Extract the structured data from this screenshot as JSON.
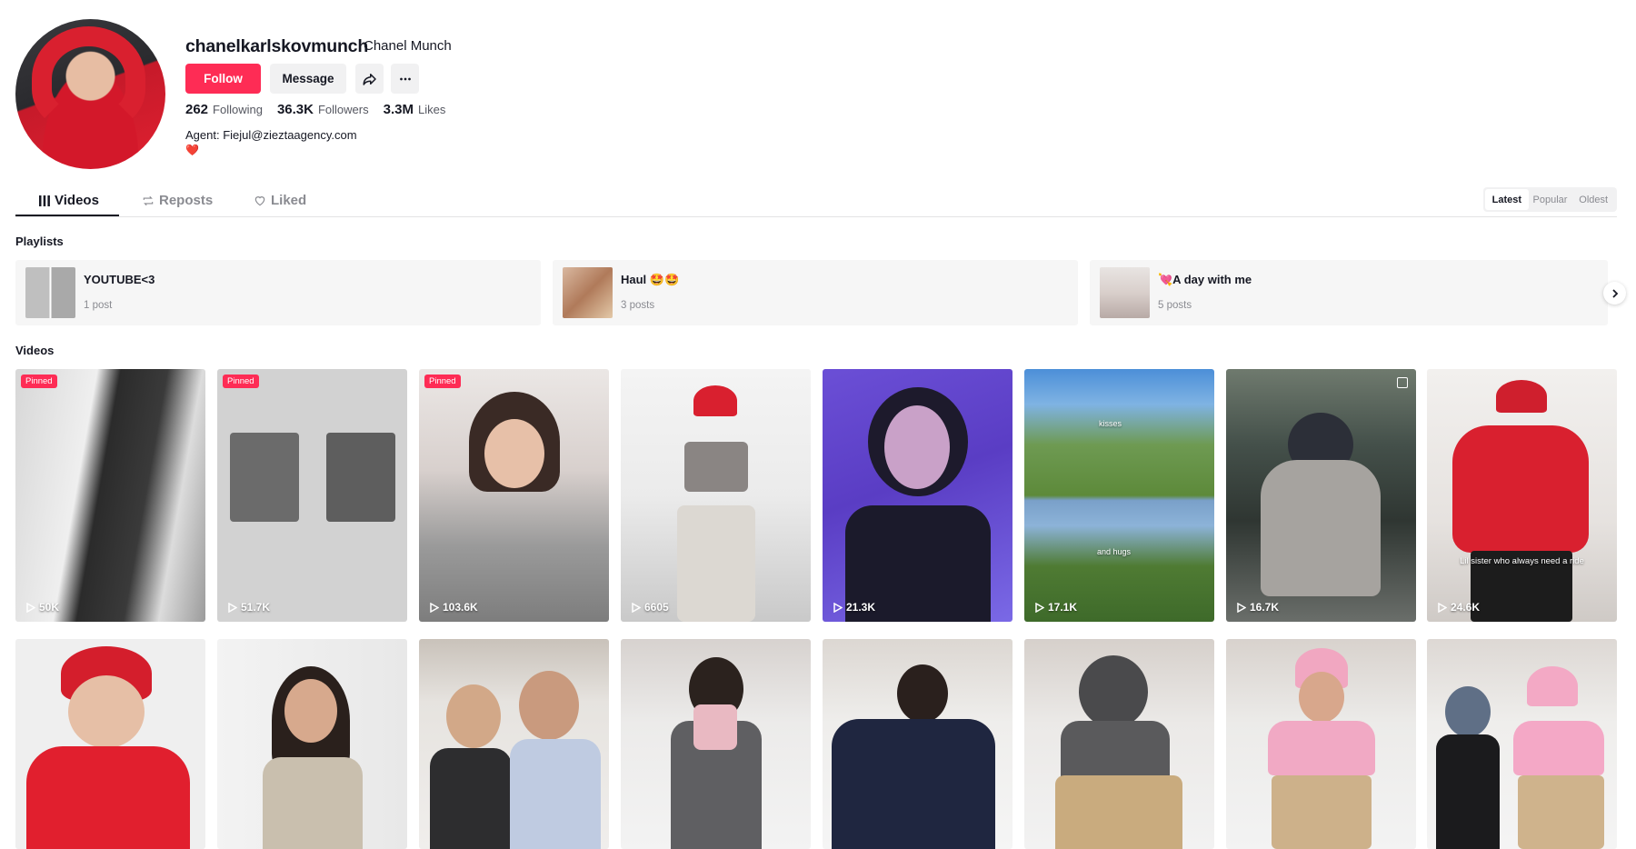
{
  "profile": {
    "username": "chanelkarlskovmunch",
    "nickname": "Chanel Munch",
    "follow_label": "Follow",
    "message_label": "Message",
    "stats": [
      {
        "value": "262",
        "label": "Following"
      },
      {
        "value": "36.3K",
        "label": "Followers"
      },
      {
        "value": "3.3M",
        "label": "Likes"
      }
    ],
    "bio_line1": "Agent: Fiejul@zieztaagency.com",
    "bio_line2": "❤️"
  },
  "tabs": [
    {
      "label": "Videos",
      "icon": "grid-icon",
      "active": true
    },
    {
      "label": "Reposts",
      "icon": "repost-icon",
      "active": false
    },
    {
      "label": "Liked",
      "icon": "heart-outline-icon",
      "active": false
    }
  ],
  "sort_options": [
    {
      "label": "Latest",
      "active": true
    },
    {
      "label": "Popular",
      "active": false
    },
    {
      "label": "Oldest",
      "active": false
    }
  ],
  "playlists_title": "Playlists",
  "playlists": [
    {
      "name": "YOUTUBE<3",
      "count": "1 post"
    },
    {
      "name": "Haul 🤩🤩",
      "count": "3 posts"
    },
    {
      "name": "💘A day with me",
      "count": "5 posts"
    }
  ],
  "videos_title": "Videos",
  "videos": [
    {
      "views": "50K",
      "pinned": "Pinned",
      "caption": ""
    },
    {
      "views": "51.7K",
      "pinned": "Pinned",
      "caption": ""
    },
    {
      "views": "103.6K",
      "pinned": "Pinned",
      "caption": ""
    },
    {
      "views": "6605",
      "pinned": "",
      "caption": ""
    },
    {
      "views": "21.3K",
      "pinned": "",
      "caption": ""
    },
    {
      "views": "17.1K",
      "pinned": "",
      "caption": "",
      "overlay_top": "kisses",
      "overlay_bottom": "and hugs"
    },
    {
      "views": "16.7K",
      "pinned": "",
      "caption": ""
    },
    {
      "views": "24.6K",
      "pinned": "",
      "caption": "Lil sister who always need a ride"
    }
  ]
}
